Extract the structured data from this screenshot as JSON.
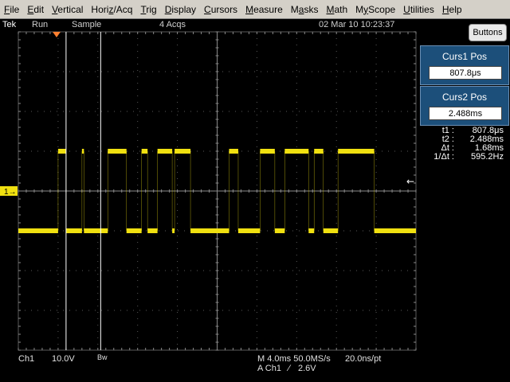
{
  "menu": [
    "File",
    "Edit",
    "Vertical",
    "Horiz/Acq",
    "Trig",
    "Display",
    "Cursors",
    "Measure",
    "Masks",
    "Math",
    "MyScope",
    "Utilities",
    "Help"
  ],
  "menu_keys": [
    "F",
    "E",
    "V",
    "z",
    "T",
    "D",
    "C",
    "M",
    "a",
    "M",
    "y",
    "U",
    "H"
  ],
  "status": {
    "brand": "Tek",
    "mode": "Run",
    "acq": "Sample",
    "acqs": "4 Acqs",
    "datetime": "02 Mar 10 10:23:37"
  },
  "buttons_label": "Buttons",
  "curs1": {
    "title": "Curs1 Pos",
    "value": "807.8μs"
  },
  "curs2": {
    "title": "Curs2 Pos",
    "value": "2.488ms"
  },
  "readouts": [
    {
      "label": "t1 :",
      "value": "807.8μs"
    },
    {
      "label": "t2 :",
      "value": "2.488ms"
    },
    {
      "label": "Δt :",
      "value": "1.68ms"
    },
    {
      "label": "1/Δt :",
      "value": "595.2Hz"
    }
  ],
  "bottom": {
    "channel": "Ch1",
    "scale": "10.0V",
    "bw": "Bw",
    "timebase": "M 4.0ms 50.0MS/s",
    "sample_interval": "20.0ns/pt",
    "trigger_source": "A Ch1",
    "trigger_slope": "∕",
    "trigger_level": "2.6V"
  },
  "channel_marker": "1→",
  "trigger_arrow": "←",
  "colors": {
    "trace": "#f0e010",
    "grid": "#5a5a5a",
    "panel": "#1c4f7a",
    "menubar": "#d4d0c8"
  },
  "chart_data": {
    "type": "line",
    "title": "",
    "xlabel": "",
    "ylabel": "",
    "x_units": "divisions (4.0ms/div)",
    "xlim": [
      0,
      10
    ],
    "ylim": [
      -4,
      4
    ],
    "high_level_div": 1.0,
    "low_level_div": -1.0,
    "transitions_div": [
      1.0,
      1.2,
      1.6,
      1.65,
      2.25,
      2.72,
      3.1,
      3.25,
      3.5,
      3.87,
      3.93,
      4.33,
      5.3,
      5.53,
      6.08,
      6.45,
      6.7,
      7.3,
      7.44,
      7.67,
      8.04,
      8.95
    ],
    "initial_level": "low",
    "cursor1_div": 1.0,
    "cursor2_div": 1.55
  }
}
